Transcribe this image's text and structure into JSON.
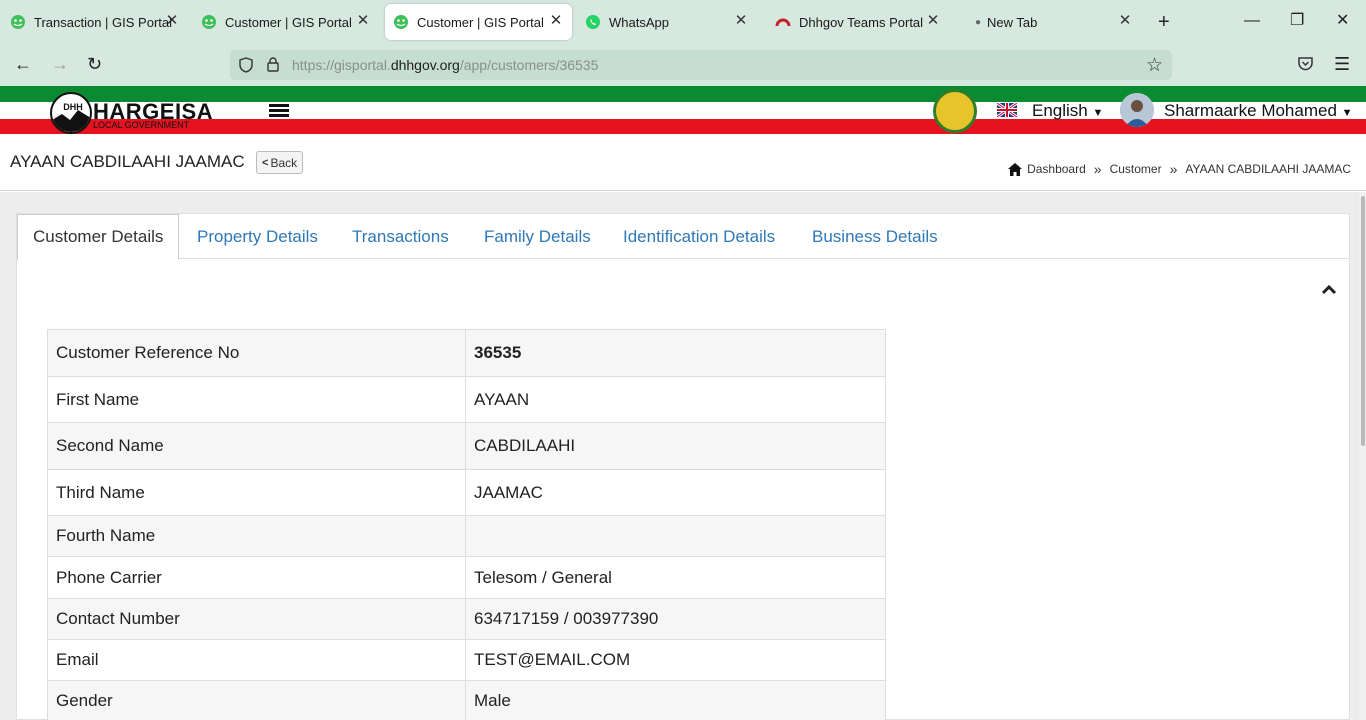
{
  "browser": {
    "tabs": [
      {
        "title": "Transaction | GIS Portal",
        "icon": "gis-portal-icon",
        "active": false
      },
      {
        "title": "Customer | GIS Portal",
        "icon": "gis-portal-icon",
        "active": false
      },
      {
        "title": "Customer | GIS Portal",
        "icon": "gis-portal-icon",
        "active": true
      },
      {
        "title": "WhatsApp",
        "icon": "whatsapp-icon",
        "active": false
      },
      {
        "title": "Dhhgov Teams Portal",
        "icon": "teams-portal-icon",
        "active": false
      },
      {
        "title": "New Tab",
        "icon": "dot-icon",
        "active": false
      }
    ],
    "url_prefix": "https://gisportal.",
    "url_domain": "dhhgov.org",
    "url_path": "/app/customers/36535"
  },
  "header": {
    "logo_text": "HARGEISA",
    "logo_subtext": "LOCAL GOVERNMENT",
    "logo_initials": "DHH",
    "language": "English",
    "user_name": "Sharmaarke Mohamed",
    "colors": {
      "green": "#0a8b33",
      "red": "#e4131f"
    }
  },
  "page": {
    "title": "AYAAN CABDILAAHI JAAMAC",
    "back_label": "Back",
    "breadcrumb": [
      "Dashboard",
      "Customer",
      "AYAAN CABDILAAHI JAAMAC"
    ]
  },
  "tabs": [
    "Customer Details",
    "Property Details",
    "Transactions",
    "Family Details",
    "Identification Details",
    "Business Details"
  ],
  "details": [
    {
      "label": "Customer Reference No",
      "value": "36535"
    },
    {
      "label": "First Name",
      "value": "AYAAN"
    },
    {
      "label": "Second Name",
      "value": "CABDILAAHI"
    },
    {
      "label": "Third Name",
      "value": "JAAMAC"
    },
    {
      "label": "Fourth Name",
      "value": ""
    },
    {
      "label": "Phone Carrier",
      "value": "Telesom / General"
    },
    {
      "label": "Contact Number",
      "value": "634717159 / 003977390"
    },
    {
      "label": "Email",
      "value": "TEST@EMAIL.COM"
    },
    {
      "label": "Gender",
      "value": "Male"
    }
  ]
}
